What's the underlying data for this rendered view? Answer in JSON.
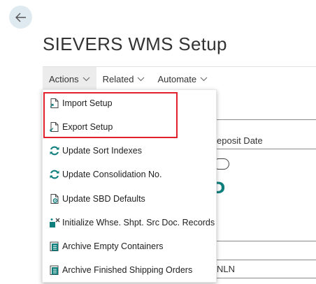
{
  "page": {
    "title": "SIEVERS WMS Setup"
  },
  "action_bar": {
    "tabs": [
      {
        "label": "Actions"
      },
      {
        "label": "Related"
      },
      {
        "label": "Automate"
      }
    ]
  },
  "background": {
    "field_label": "eposit Date",
    "field_value": "NLN"
  },
  "menu": {
    "items": [
      {
        "label": "Import Setup",
        "icon": "import-document-icon"
      },
      {
        "label": "Export Setup",
        "icon": "export-document-icon"
      },
      {
        "label": "Update Sort Indexes",
        "icon": "refresh-icon"
      },
      {
        "label": "Update Consolidation No.",
        "icon": "refresh-icon"
      },
      {
        "label": "Update SBD Defaults",
        "icon": "document-settings-icon"
      },
      {
        "label": "Initialize Whse. Shpt. Src Doc. Records",
        "icon": "initialize-icon"
      },
      {
        "label": "Archive Empty Containers",
        "icon": "archive-icon"
      },
      {
        "label": "Archive Finished Shipping Orders",
        "icon": "archive-icon"
      }
    ]
  },
  "colors": {
    "accent": "#0f7f7d",
    "highlight": "#e0202a",
    "active_tab": "#ececec"
  }
}
